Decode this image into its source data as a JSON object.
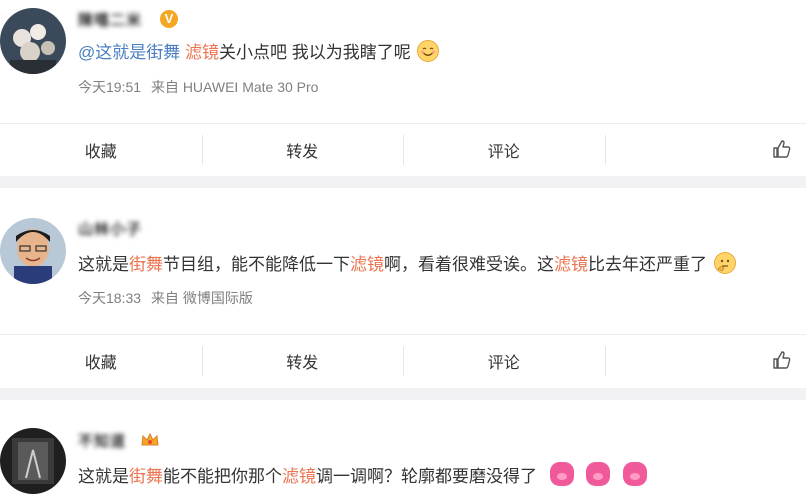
{
  "comments": [
    {
      "username": "陳嘻二米",
      "verified_badge": "V",
      "text_parts": [
        {
          "t": "@这就是街舞",
          "cls": "at"
        },
        {
          "t": " ",
          "cls": ""
        },
        {
          "t": "滤镜",
          "cls": "hl"
        },
        {
          "t": "关小点吧 我以为我瞎了呢",
          "cls": ""
        }
      ],
      "emoji": "smile-emoji",
      "time": "今天19:51",
      "source": "来自 HUAWEI Mate 30 Pro"
    },
    {
      "username": "山林小子",
      "text_parts": [
        {
          "t": "这就是",
          "cls": ""
        },
        {
          "t": "街舞",
          "cls": "hl"
        },
        {
          "t": "节目组，能不能降低一下",
          "cls": ""
        },
        {
          "t": "滤镜",
          "cls": "hl"
        },
        {
          "t": "啊，看着很难受诶。这",
          "cls": ""
        },
        {
          "t": "滤镜",
          "cls": "hl"
        },
        {
          "t": "比去年还严重了",
          "cls": ""
        }
      ],
      "emoji": "thinking-emoji",
      "time": "今天18:33",
      "source": "来自 微博国际版"
    },
    {
      "username": "不知道",
      "text_parts": [
        {
          "t": "这就是",
          "cls": ""
        },
        {
          "t": "街舞",
          "cls": "hl"
        },
        {
          "t": "能不能把你那个",
          "cls": ""
        },
        {
          "t": "滤镜",
          "cls": "hl"
        },
        {
          "t": "调一调啊？轮廓都要磨没得了",
          "cls": ""
        }
      ],
      "emoji": "pig-emoji",
      "emoji_count": 3
    }
  ],
  "actions": {
    "collect": "收藏",
    "repost": "转发",
    "comment": "评论"
  },
  "colors": {
    "highlight": "#eb7350",
    "mention": "#4a7fc1",
    "separator": "#f2f2f5"
  }
}
